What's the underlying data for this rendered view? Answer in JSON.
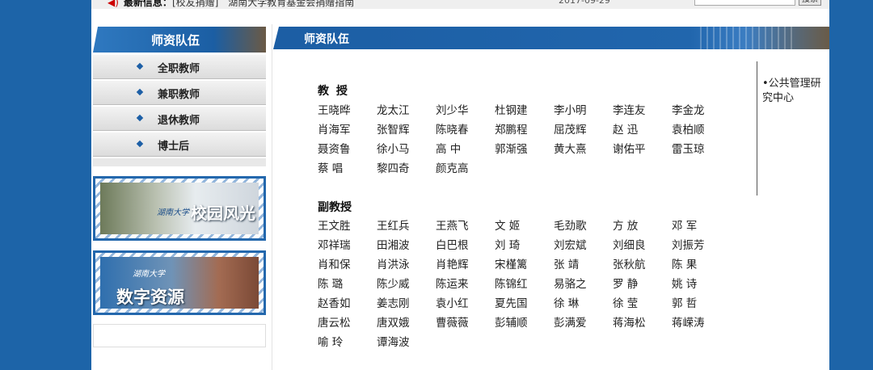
{
  "topbar": {
    "news_prefix": "最新信息：",
    "news_text": "[校友捐赠]　湖南大学教育基金会捐赠指南",
    "date": "2017-09-29",
    "search_button": "搜索"
  },
  "sidebar": {
    "title": "师资队伍",
    "items": [
      {
        "label": "全职教师"
      },
      {
        "label": "兼职教师"
      },
      {
        "label": "退休教师"
      },
      {
        "label": "博士后"
      }
    ],
    "banner1": {
      "emblem": "湖南大学",
      "text": "校园风光"
    },
    "banner2": {
      "emblem": "湖南大学",
      "text": "数字资源"
    }
  },
  "main": {
    "header": "师资队伍",
    "professor_title": "教 授",
    "professors": [
      "王晓晔",
      "龙太江",
      "刘少华",
      "杜钢建",
      "李小明",
      "李连友",
      "李金龙",
      "肖海军",
      "张智辉",
      "陈晓春",
      "郑鹏程",
      "屈茂辉",
      "赵 迅",
      "袁柏顺",
      "聂资鲁",
      "徐小马",
      "高 中",
      "郭渐强",
      "黄大熹",
      "谢佑平",
      "雷玉琼",
      "蔡 唱",
      "黎四奇",
      "颜克高"
    ],
    "associate_title": "副教授",
    "associates": [
      "王文胜",
      "王红兵",
      "王燕飞",
      "文 姬",
      "毛劲歌",
      "方 放",
      "邓 军",
      "邓祥瑞",
      "田湘波",
      "白巴根",
      "刘 琦",
      "刘宏斌",
      "刘细良",
      "刘振芳",
      "肖和保",
      "肖洪泳",
      "肖艳辉",
      "宋槿篱",
      "张 靖",
      "张秋航",
      "陈 果",
      "陈 璐",
      "陈少威",
      "陈运来",
      "陈锦红",
      "易骆之",
      "罗 静",
      "姚 诗",
      "赵香如",
      "姜志刚",
      "袁小红",
      "夏先国",
      "徐 琳",
      "徐 莹",
      "郭 哲",
      "唐云松",
      "唐双娥",
      "曹薇薇",
      "彭辅顺",
      "彭满爱",
      "蒋海松",
      "蒋嵘涛",
      "喻 玲",
      "谭海波"
    ]
  },
  "right": {
    "link": "•公共管理研究中心"
  }
}
